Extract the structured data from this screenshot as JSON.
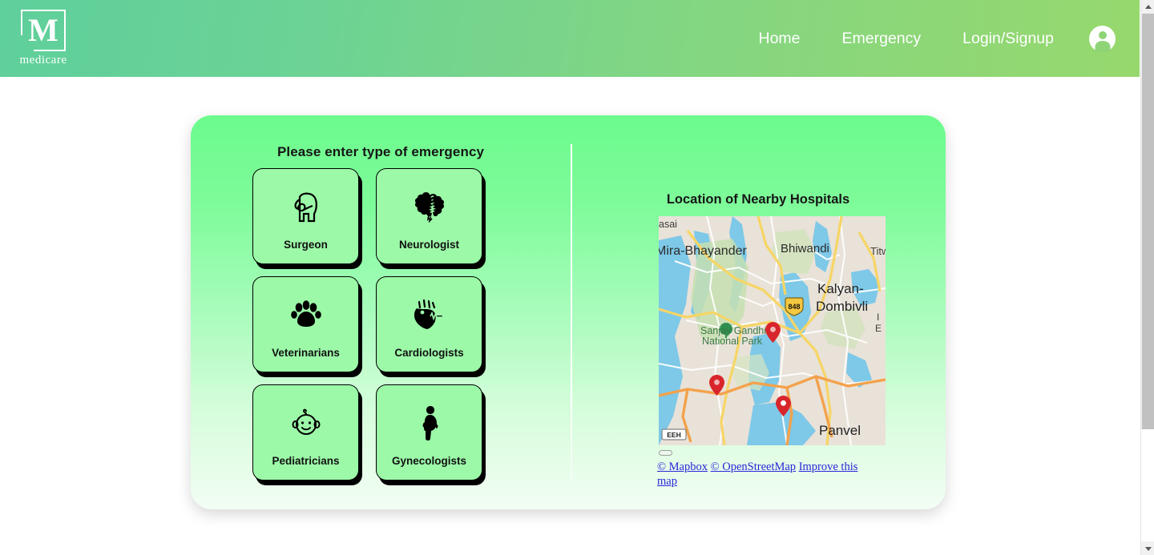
{
  "header": {
    "logo": {
      "mark": "M",
      "wordmark": "medicare",
      "icon_name": "medicare-logo"
    },
    "nav": [
      {
        "label": "Home",
        "name": "nav-link-home"
      },
      {
        "label": "Emergency",
        "name": "nav-link-emergency"
      },
      {
        "label": "Login/Signup",
        "name": "nav-link-login-signup"
      }
    ],
    "avatar_icon": "user-avatar-icon",
    "gradient_from": "#5fcf9c",
    "gradient_to": "#97d86d"
  },
  "panel": {
    "left": {
      "title": "Please enter type of emergency",
      "cards": [
        {
          "label": "Surgeon",
          "icon": "surgeon-head-icon"
        },
        {
          "label": "Neurologist",
          "icon": "brain-icon"
        },
        {
          "label": "Veterinarians",
          "icon": "paw-print-icon"
        },
        {
          "label": "Cardiologists",
          "icon": "heart-ecg-icon"
        },
        {
          "label": "Pediatricians",
          "icon": "baby-face-icon"
        },
        {
          "label": "Gynecologists",
          "icon": "pregnant-woman-icon"
        }
      ]
    },
    "right": {
      "title": "Location of Nearby Hospitals",
      "map": {
        "labels": [
          "asai",
          "Mira-Bhayander",
          "Bhiwandi",
          "Titw",
          "Kalyan-",
          "Dombivli",
          "Sanjay Gandhi",
          "National Park",
          "Panvel",
          "E"
        ],
        "highway_shield": "848",
        "scale_badge": "EEH",
        "marker_count": 3,
        "marker_color": "#d8252b"
      },
      "attribution": {
        "mapbox": "© Mapbox",
        "osm": "© OpenStreetMap",
        "improve": "Improve this map"
      }
    }
  }
}
